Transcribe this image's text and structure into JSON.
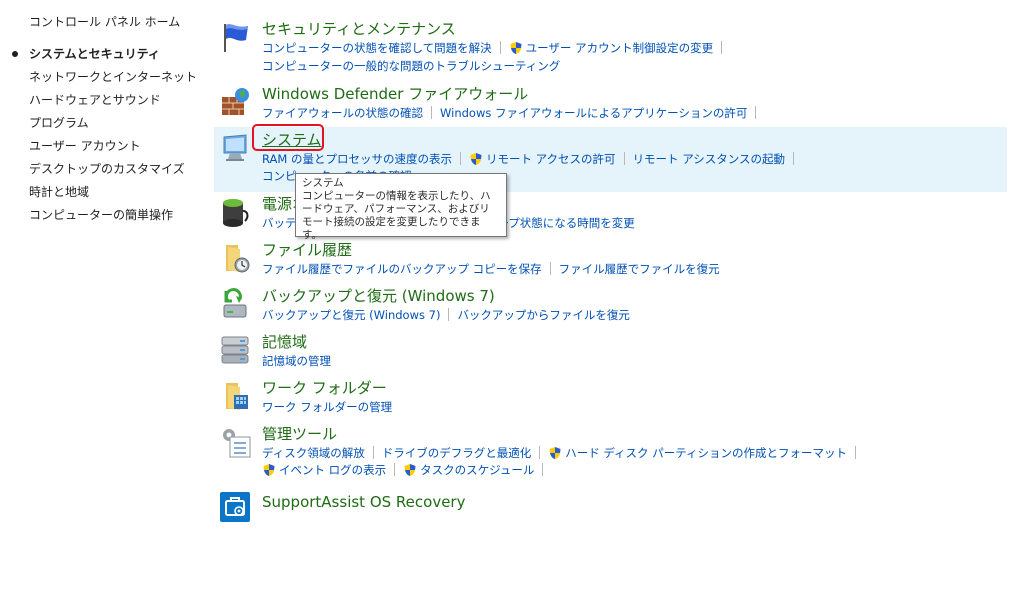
{
  "sidebar": {
    "home": "コントロール パネル ホーム",
    "items": [
      {
        "label": "システムとセキュリティ",
        "current": true
      },
      {
        "label": "ネットワークとインターネット"
      },
      {
        "label": "ハードウェアとサウンド"
      },
      {
        "label": "プログラム"
      },
      {
        "label": "ユーザー アカウント"
      },
      {
        "label": "デスクトップのカスタマイズ"
      },
      {
        "label": "時計と地域"
      },
      {
        "label": "コンピューターの簡単操作"
      }
    ]
  },
  "categories": {
    "security": {
      "icon": "flag-icon",
      "title": "セキュリティとメンテナンス",
      "link1": "コンピューターの状態を確認して問題を解決",
      "link2": "ユーザー アカウント制御設定の変更",
      "link3": "コンピューターの一般的な問題のトラブルシューティング"
    },
    "firewall": {
      "icon": "firewall-icon",
      "title": "Windows Defender ファイアウォール",
      "link1": "ファイアウォールの状態の確認",
      "link2": "Windows ファイアウォールによるアプリケーションの許可"
    },
    "system": {
      "icon": "computer-icon",
      "title": "システム",
      "link1": "RAM の量とプロセッサの速度の表示",
      "link2": "リモート アクセスの許可",
      "link3": "リモート アシスタンスの起動",
      "link4": "コンピューターの名前の確認"
    },
    "power": {
      "icon": "battery-icon",
      "title": "電源オプション",
      "link1": "バッテリ設定の変更",
      "link2": "コンピューターがスリープ状態になる時間を変更"
    },
    "filehistory": {
      "icon": "folder-clock-icon",
      "title": "ファイル履歴",
      "link1": "ファイル履歴でファイルのバックアップ コピーを保存",
      "link2": "ファイル履歴でファイルを復元"
    },
    "backup": {
      "icon": "backup-icon",
      "title": "バックアップと復元 (Windows 7)",
      "link1": "バックアップと復元 (Windows 7)",
      "link2": "バックアップからファイルを復元"
    },
    "storage": {
      "icon": "storage-icon",
      "title": "記憶域",
      "link1": "記憶域の管理"
    },
    "workfolders": {
      "icon": "work-folder-icon",
      "title": "ワーク フォルダー",
      "link1": "ワーク フォルダーの管理"
    },
    "admintools": {
      "icon": "admin-tools-icon",
      "title": "管理ツール",
      "link1": "ディスク領域の解放",
      "link2": "ドライブのデフラグと最適化",
      "link3": "ハード ディスク パーティションの作成とフォーマット",
      "link4": "イベント ログの表示",
      "link5": "タスクのスケジュール"
    },
    "supportassist": {
      "icon": "supportassist-icon",
      "title": "SupportAssist OS Recovery"
    }
  },
  "tooltip": {
    "title": "システム",
    "body": "コンピューターの情報を表示したり、ハードウェア、パフォーマンス、およびリモート接続の設定を変更したりできます。"
  },
  "colors": {
    "title_green": "#1e6c14",
    "link_blue": "#0050b4",
    "hover_bg": "#e5f3fb",
    "focus_red": "#e81123"
  }
}
